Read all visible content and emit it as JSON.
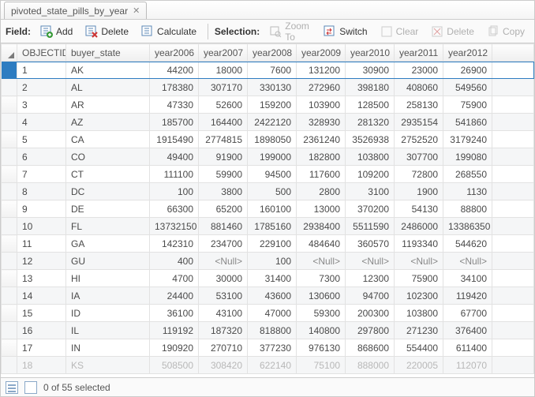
{
  "tab": {
    "title": "pivoted_state_pills_by_year"
  },
  "toolbar": {
    "field_label": "Field:",
    "add": "Add",
    "delete_field": "Delete",
    "calculate": "Calculate",
    "selection_label": "Selection:",
    "zoom_to": "Zoom To",
    "switch": "Switch",
    "clear": "Clear",
    "delete_sel": "Delete",
    "copy": "Copy"
  },
  "columns": {
    "objectid": "OBJECTID",
    "buyer_state": "buyer_state",
    "year2006": "year2006",
    "year2007": "year2007",
    "year2008": "year2008",
    "year2009": "year2009",
    "year2010": "year2010",
    "year2011": "year2011",
    "year2012": "year2012"
  },
  "null_text": "<Null>",
  "rows": [
    {
      "id": "1",
      "state": "AK",
      "y06": "44200",
      "y07": "18000",
      "y08": "7600",
      "y09": "131200",
      "y10": "30900",
      "y11": "23000",
      "y12": "26900"
    },
    {
      "id": "2",
      "state": "AL",
      "y06": "178380",
      "y07": "307170",
      "y08": "330130",
      "y09": "272960",
      "y10": "398180",
      "y11": "408060",
      "y12": "549560"
    },
    {
      "id": "3",
      "state": "AR",
      "y06": "47330",
      "y07": "52600",
      "y08": "159200",
      "y09": "103900",
      "y10": "128500",
      "y11": "258130",
      "y12": "75900"
    },
    {
      "id": "4",
      "state": "AZ",
      "y06": "185700",
      "y07": "164400",
      "y08": "2422120",
      "y09": "328930",
      "y10": "281320",
      "y11": "2935154",
      "y12": "541860"
    },
    {
      "id": "5",
      "state": "CA",
      "y06": "1915490",
      "y07": "2774815",
      "y08": "1898050",
      "y09": "2361240",
      "y10": "3526938",
      "y11": "2752520",
      "y12": "3179240"
    },
    {
      "id": "6",
      "state": "CO",
      "y06": "49400",
      "y07": "91900",
      "y08": "199000",
      "y09": "182800",
      "y10": "103800",
      "y11": "307700",
      "y12": "199080"
    },
    {
      "id": "7",
      "state": "CT",
      "y06": "111100",
      "y07": "59900",
      "y08": "94500",
      "y09": "117600",
      "y10": "109200",
      "y11": "72800",
      "y12": "268550"
    },
    {
      "id": "8",
      "state": "DC",
      "y06": "100",
      "y07": "3800",
      "y08": "500",
      "y09": "2800",
      "y10": "3100",
      "y11": "1900",
      "y12": "1130"
    },
    {
      "id": "9",
      "state": "DE",
      "y06": "66300",
      "y07": "65200",
      "y08": "160100",
      "y09": "13000",
      "y10": "370200",
      "y11": "54130",
      "y12": "88800"
    },
    {
      "id": "10",
      "state": "FL",
      "y06": "13732150",
      "y07": "881460",
      "y08": "1785160",
      "y09": "2938400",
      "y10": "5511590",
      "y11": "2486000",
      "y12": "13386350"
    },
    {
      "id": "11",
      "state": "GA",
      "y06": "142310",
      "y07": "234700",
      "y08": "229100",
      "y09": "484640",
      "y10": "360570",
      "y11": "1193340",
      "y12": "544620"
    },
    {
      "id": "12",
      "state": "GU",
      "y06": "400",
      "y07": null,
      "y08": "100",
      "y09": null,
      "y10": null,
      "y11": null,
      "y12": null
    },
    {
      "id": "13",
      "state": "HI",
      "y06": "4700",
      "y07": "30000",
      "y08": "31400",
      "y09": "7300",
      "y10": "12300",
      "y11": "75900",
      "y12": "34100"
    },
    {
      "id": "14",
      "state": "IA",
      "y06": "24400",
      "y07": "53100",
      "y08": "43600",
      "y09": "130600",
      "y10": "94700",
      "y11": "102300",
      "y12": "119420"
    },
    {
      "id": "15",
      "state": "ID",
      "y06": "36100",
      "y07": "43100",
      "y08": "47000",
      "y09": "59300",
      "y10": "200300",
      "y11": "103800",
      "y12": "67700"
    },
    {
      "id": "16",
      "state": "IL",
      "y06": "119192",
      "y07": "187320",
      "y08": "818800",
      "y09": "140800",
      "y10": "297800",
      "y11": "271230",
      "y12": "376400"
    },
    {
      "id": "17",
      "state": "IN",
      "y06": "190920",
      "y07": "270710",
      "y08": "377230",
      "y09": "976130",
      "y10": "868600",
      "y11": "554400",
      "y12": "611400"
    },
    {
      "id": "18",
      "state": "KS",
      "y06": "508500",
      "y07": "308420",
      "y08": "622140",
      "y09": "75100",
      "y10": "888000",
      "y11": "220005",
      "y12": "112070"
    }
  ],
  "status": {
    "text": "0 of 55 selected"
  }
}
